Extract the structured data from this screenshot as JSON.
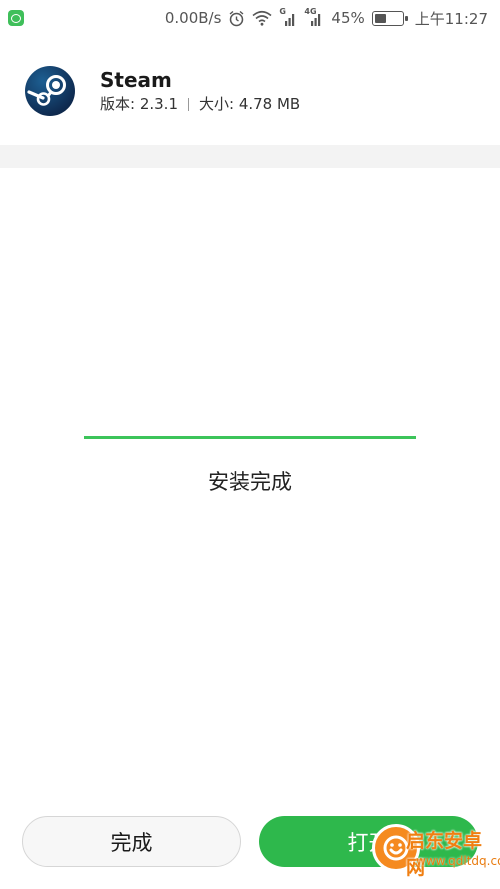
{
  "status_bar": {
    "net_speed": "0.00B/s",
    "signal1_label": "G",
    "signal2_label": "4G",
    "battery": "45%",
    "battery_level": 0.45,
    "time": "上午11:27"
  },
  "app": {
    "name": "Steam",
    "version": "版本: 2.3.1",
    "size": "大小: 4.78 MB"
  },
  "install": {
    "progress": 1.0,
    "status": "安装完成"
  },
  "buttons": {
    "done": "完成",
    "open": "打开"
  },
  "watermark": {
    "name": "启东安卓网",
    "url": "www.qdltdq.com"
  },
  "colors": {
    "accent": "#2eb84c",
    "progress": "#3cc45a"
  }
}
